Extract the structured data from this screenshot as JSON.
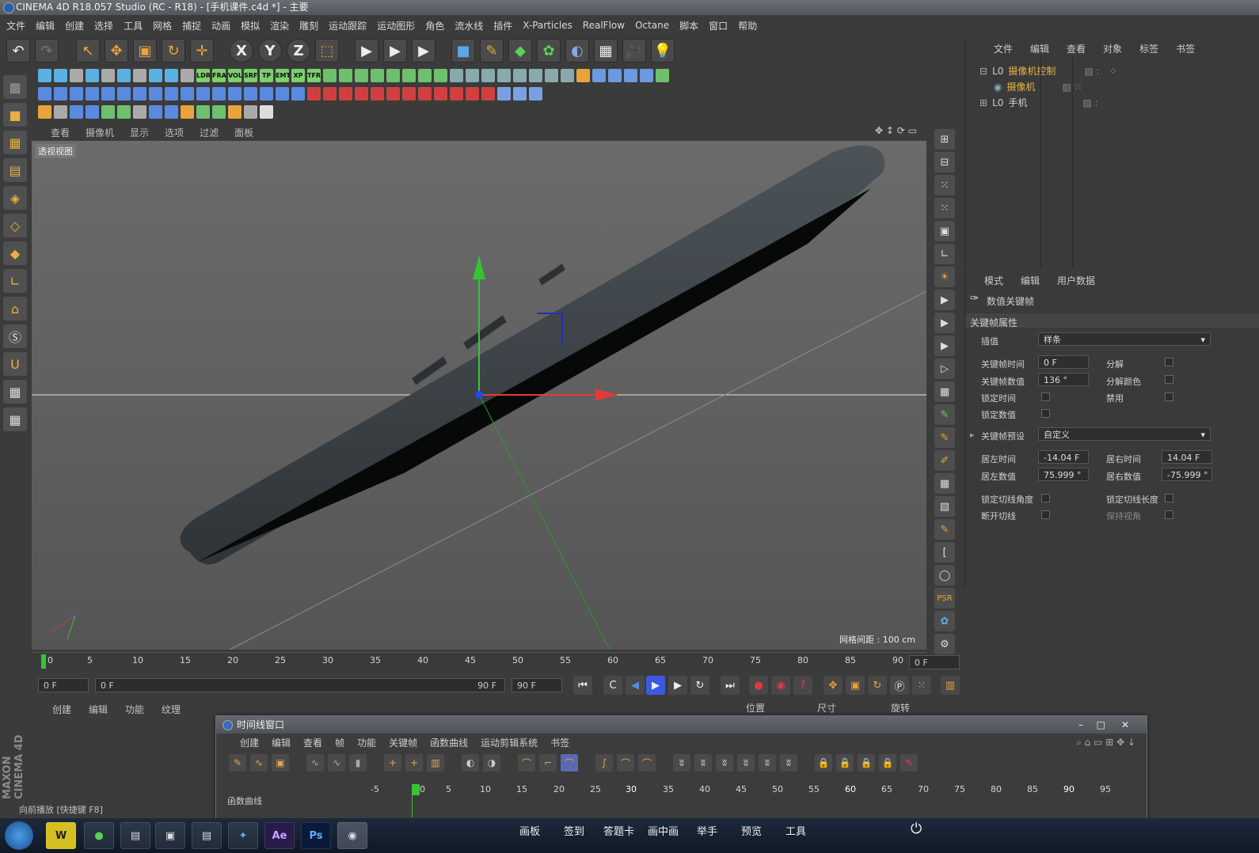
{
  "window": {
    "title": "CINEMA 4D R18.057 Studio (RC - R18) - [手机课件.c4d *] - 主要"
  },
  "menu": [
    "文件",
    "编辑",
    "创建",
    "选择",
    "工具",
    "网格",
    "捕捉",
    "动画",
    "模拟",
    "渲染",
    "雕刻",
    "运动跟踪",
    "运动图形",
    "角色",
    "流水线",
    "插件",
    "X-Particles",
    "RealFlow",
    "Octane",
    "脚本",
    "窗口",
    "帮助"
  ],
  "toolbar_icons": {
    "undo": "↶",
    "redo": "↷",
    "select": "↖",
    "move": "✥",
    "scale": "▣",
    "rotate": "↻",
    "add": "✛",
    "x": "X",
    "y": "Y",
    "z": "Z",
    "coord": "⬚",
    "render_view": "▶",
    "render": "▶",
    "render_settings": "▶",
    "cube": "■",
    "pen": "✎",
    "nurbs": "◆",
    "cloner": "✿",
    "deformer": "◐",
    "floor": "▦",
    "camera": "🎥",
    "light": "💡"
  },
  "sub_toolbar_labels": [
    "LDR",
    "FRA",
    "VOL",
    "SRF",
    "TP",
    "EMT",
    "XP",
    "TFR"
  ],
  "viewport": {
    "menu": [
      "查看",
      "摄像机",
      "显示",
      "选项",
      "过滤",
      "面板"
    ],
    "label": "透视视图",
    "grid_spacing": "网格间距 : 100 cm"
  },
  "object_manager": {
    "menu": [
      "文件",
      "编辑",
      "查看",
      "对象",
      "标签",
      "书签"
    ],
    "objects": [
      {
        "name": "摄像机控制",
        "color": "#e8b341"
      },
      {
        "name": "摄像机",
        "color": "#e8b341"
      },
      {
        "name": "手机",
        "color": "#cfcfcf"
      }
    ]
  },
  "attribute_manager": {
    "menu": [
      "模式",
      "编辑",
      "用户数据"
    ],
    "header": "数值关键帧",
    "section": "关键帧属性",
    "interpolation_label": "插值",
    "interpolation_value": "样条",
    "key_time_label": "关键帧时间",
    "key_time_value": "0 F",
    "key_value_label": "关键帧数值",
    "key_value_value": "136 °",
    "lock_time_label": "锁定时间",
    "lock_value_label": "锁定数值",
    "break_label": "分解",
    "break_color_label": "分解颜色",
    "mute_label": "禁用",
    "preset_label": "关键帧预设",
    "preset_value": "自定义",
    "left_time_label": "居左时间",
    "left_time_value": "-14.04 F",
    "right_time_label": "居右时间",
    "right_time_value": "14.04 F",
    "left_value_label": "居左数值",
    "left_value_value": "75.999 °",
    "right_value_label": "居右数值",
    "right_value_value": "-75.999 °",
    "lock_tangent_angle_label": "锁定切线角度",
    "lock_tangent_length_label": "锁定切线长度",
    "break_tangent_label": "断开切线",
    "keep_visual_label": "保持视角"
  },
  "timeline": {
    "ticks": [
      "0",
      "5",
      "10",
      "15",
      "20",
      "25",
      "30",
      "35",
      "40",
      "45",
      "50",
      "55",
      "60",
      "65",
      "70",
      "75",
      "80",
      "85",
      "90"
    ],
    "current_frame": "0 F",
    "start_frame": "0 F",
    "range_start": "0 F",
    "range_end": "90 F",
    "end_frame": "90 F"
  },
  "material_menu": [
    "创建",
    "编辑",
    "功能",
    "纹理"
  ],
  "coord_headers": [
    "位置",
    "尺寸",
    "旋转"
  ],
  "timeline_window": {
    "title": "时间线窗口",
    "menu": [
      "创建",
      "编辑",
      "查看",
      "帧",
      "功能",
      "关键帧",
      "函数曲线",
      "运动剪辑系统",
      "书签"
    ],
    "track_label": "函数曲线",
    "ruler": [
      "-5",
      "0",
      "5",
      "10",
      "15",
      "20",
      "25",
      "30",
      "35",
      "40",
      "45",
      "50",
      "55",
      "60",
      "65",
      "70",
      "75",
      "80",
      "85",
      "90",
      "95"
    ],
    "window_buttons": [
      "–",
      "□",
      "✕"
    ]
  },
  "status_text": "向前播放 [快捷键 F8]",
  "side_brand": "MAXON CINEMA 4D",
  "taskbar": {
    "apps": [
      "W",
      "●",
      "▤",
      "▣",
      "▤",
      "✦",
      "Ae",
      "Ps",
      "◉"
    ],
    "items": [
      "画板",
      "签到",
      "答题卡",
      "画中画",
      "举手",
      "预览",
      "工具"
    ],
    "power_icon": "⏻"
  },
  "colors": {
    "accent_orange": "#e8a33a",
    "axis_x": "#e23b3b",
    "axis_y": "#35c435",
    "axis_z": "#3050d8",
    "playhead": "#35c435"
  }
}
